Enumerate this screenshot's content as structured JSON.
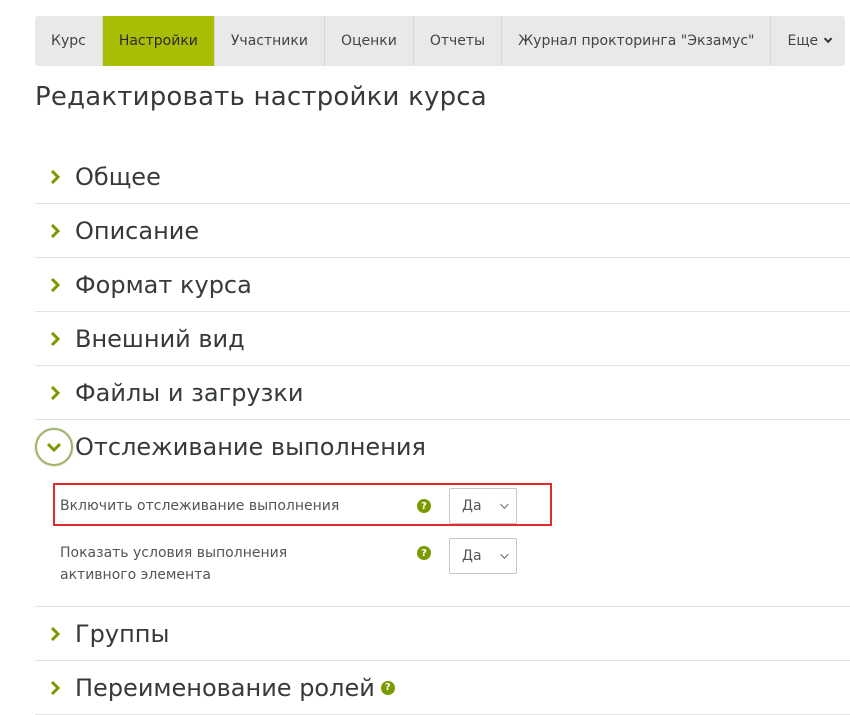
{
  "tabs": [
    {
      "label": "Курс",
      "active": false
    },
    {
      "label": "Настройки",
      "active": true
    },
    {
      "label": "Участники",
      "active": false
    },
    {
      "label": "Оценки",
      "active": false
    },
    {
      "label": "Отчеты",
      "active": false
    },
    {
      "label": "Журнал прокторинга \"Экзамус\"",
      "active": false
    },
    {
      "label": "Еще",
      "active": false
    }
  ],
  "page_title": "Редактировать настройки курса",
  "sections": {
    "general": "Общее",
    "description": "Описание",
    "format": "Формат курса",
    "appearance": "Внешний вид",
    "files": "Файлы и загрузки",
    "completion": "Отслеживание выполнения",
    "groups": "Группы",
    "roles": "Переименование ролей"
  },
  "completion_fields": {
    "enable_label": "Включить отслеживание выполнения",
    "enable_value": "Да",
    "show_label": "Показать условия выполнения активного элемента",
    "show_value": "Да"
  },
  "icons": {
    "help": "question-circle-icon",
    "chevron": "chevron-icon"
  },
  "colors": {
    "accent": "#a9bd05",
    "icon_green": "#7a9a01",
    "highlight": "#e32a2a"
  }
}
